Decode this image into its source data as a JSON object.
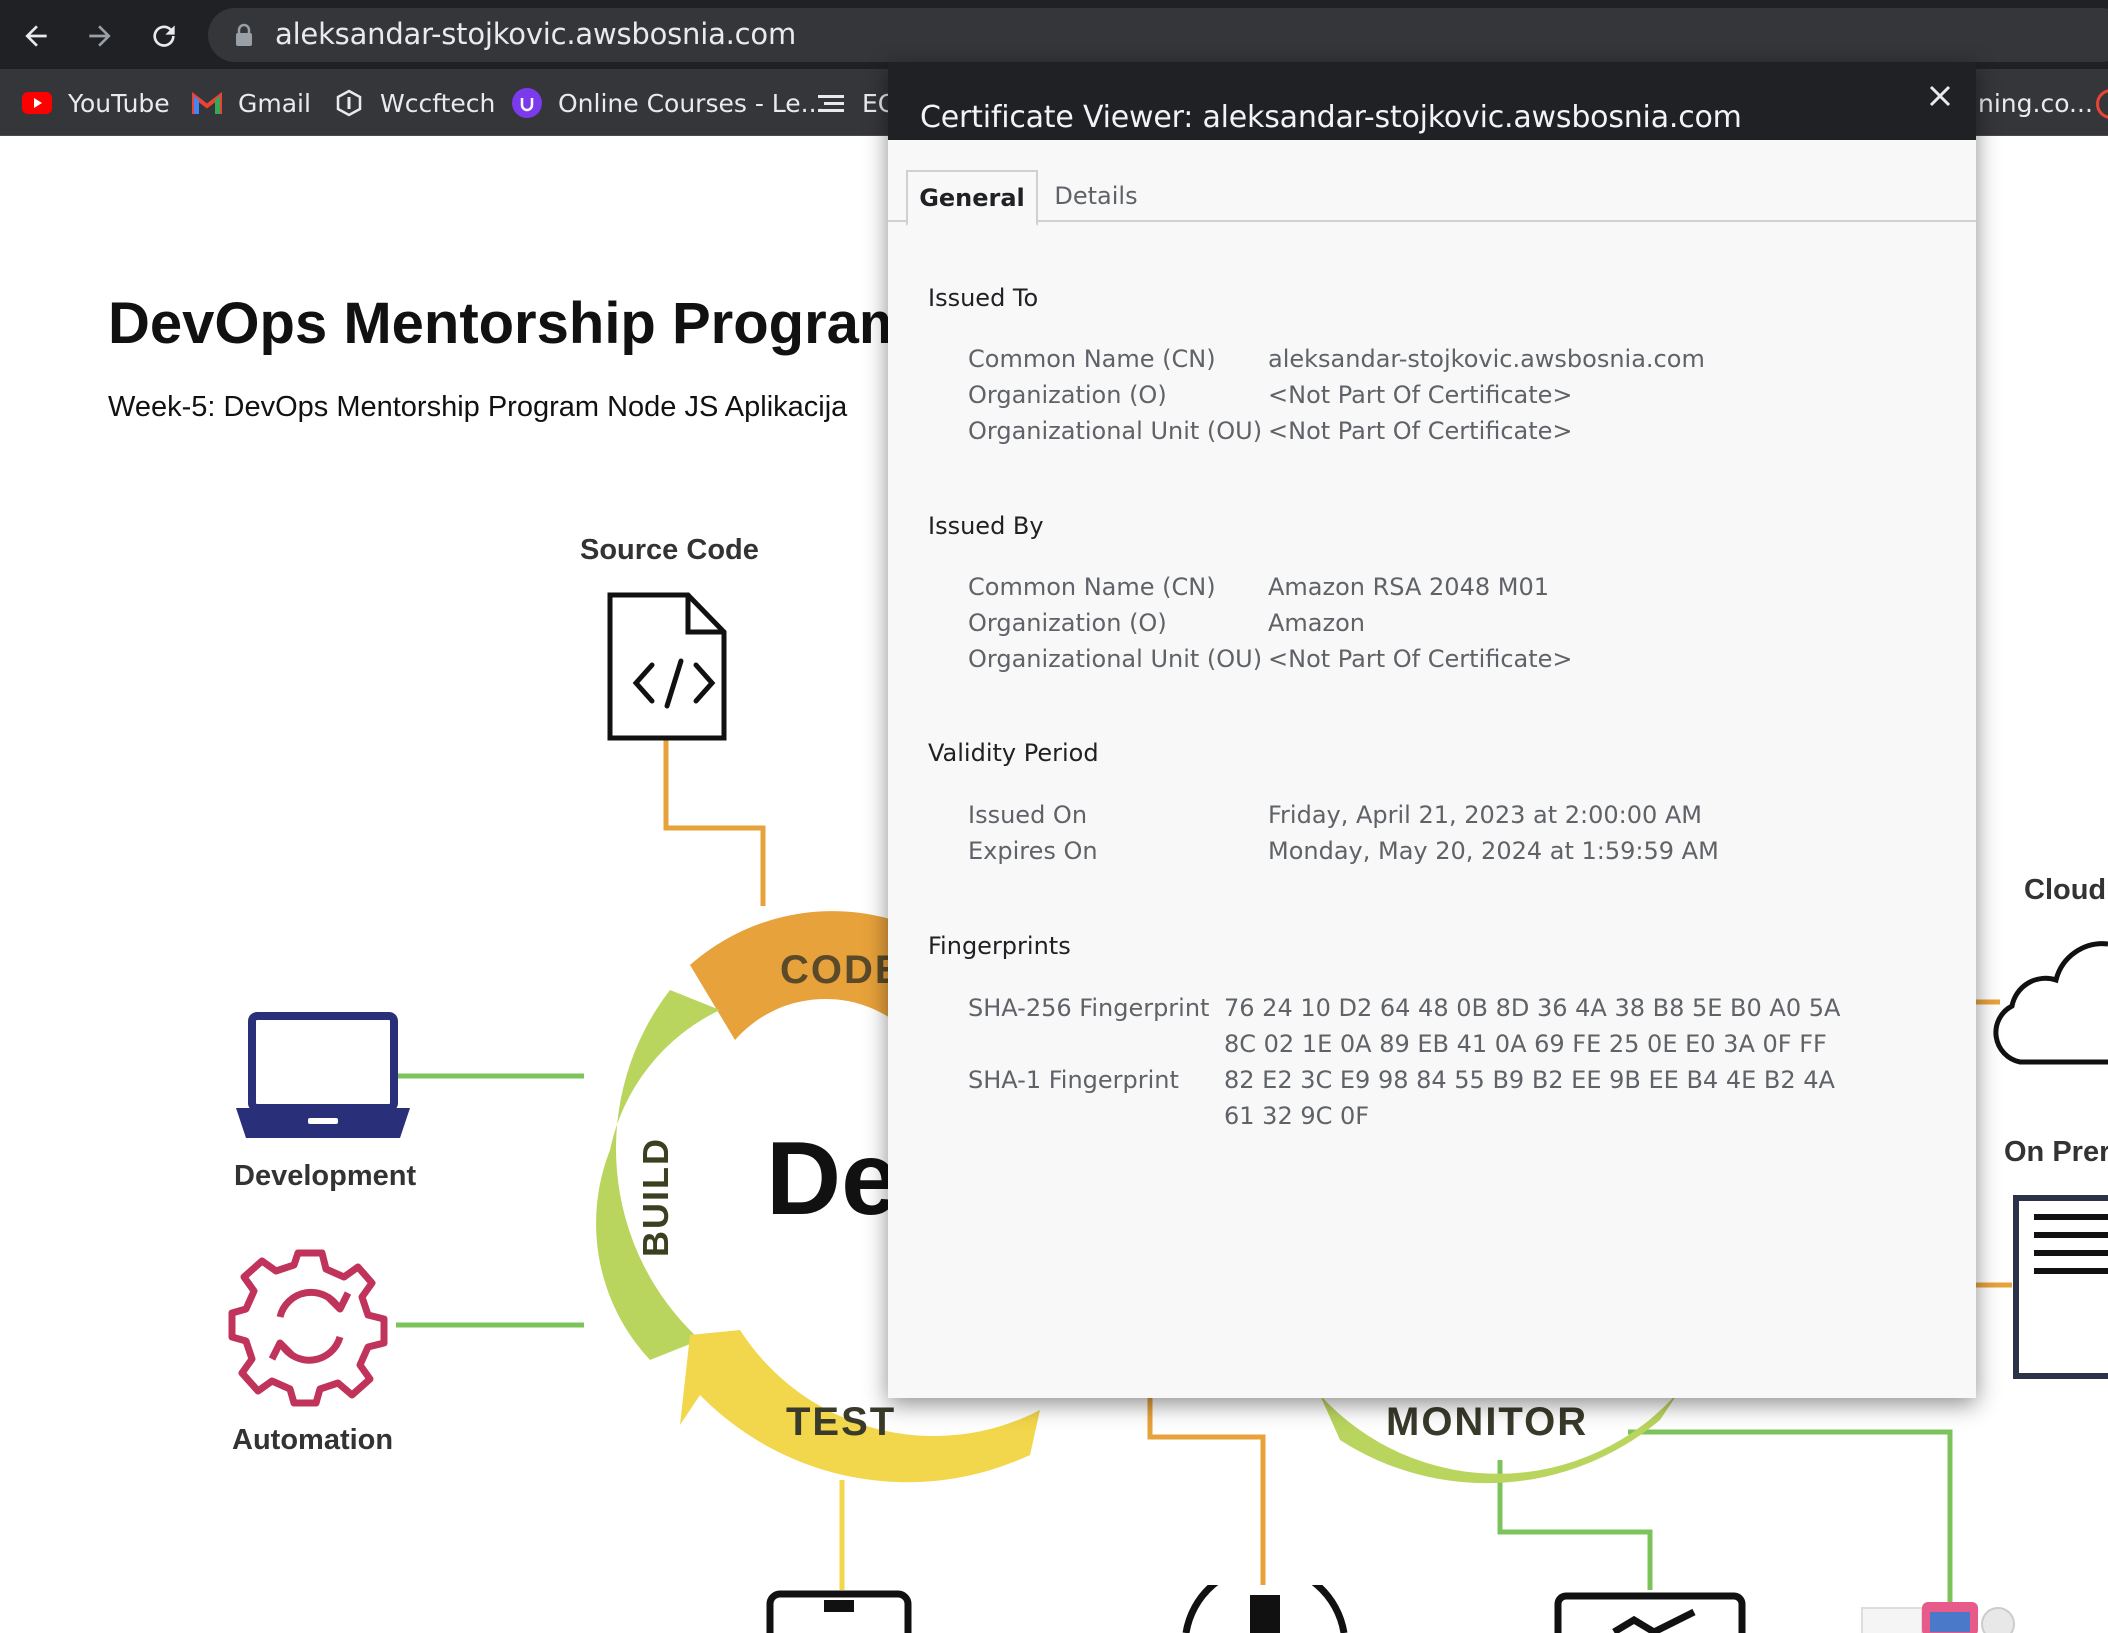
{
  "browser": {
    "url": "aleksandar-stojkovic.awsbosnia.com",
    "bookmarks": [
      {
        "label": "YouTube",
        "icon": "youtube-icon"
      },
      {
        "label": "Gmail",
        "icon": "gmail-icon"
      },
      {
        "label": "Wccftech",
        "icon": "wccftech-icon"
      },
      {
        "label": "Online Courses - Le...",
        "icon": "udemy-icon"
      },
      {
        "label": "EC",
        "icon": "bookmark-icon"
      },
      {
        "label": "ning.co...",
        "icon": "bookmark-icon"
      }
    ]
  },
  "page": {
    "title": "DevOps Mentorship Program",
    "subtitle": "Week-5: DevOps Mentorship Program Node JS Aplikacija",
    "diagram": {
      "source_code": "Source Code",
      "development": "Development",
      "automation": "Automation",
      "cloud": "Cloud",
      "on_prem": "On Prer",
      "cycle_code": "CODE",
      "cycle_build": "BUILD",
      "cycle_test": "TEST",
      "cycle_monitor": "MONITOR",
      "center_text": "De"
    }
  },
  "certificate_viewer": {
    "title": "Certificate Viewer: aleksandar-stojkovic.awsbosnia.com",
    "tabs": [
      "General",
      "Details"
    ],
    "active_tab": "General",
    "issued_to": {
      "heading": "Issued To",
      "rows": [
        {
          "label": "Common Name (CN)",
          "value": "aleksandar-stojkovic.awsbosnia.com"
        },
        {
          "label": "Organization (O)",
          "value": "<Not Part Of Certificate>"
        },
        {
          "label": "Organizational Unit (OU)",
          "value": "<Not Part Of Certificate>"
        }
      ]
    },
    "issued_by": {
      "heading": "Issued By",
      "rows": [
        {
          "label": "Common Name (CN)",
          "value": "Amazon RSA 2048 M01"
        },
        {
          "label": "Organization (O)",
          "value": "Amazon"
        },
        {
          "label": "Organizational Unit (OU)",
          "value": "<Not Part Of Certificate>"
        }
      ]
    },
    "validity": {
      "heading": "Validity Period",
      "rows": [
        {
          "label": "Issued On",
          "value": "Friday, April 21, 2023 at 2:00:00 AM"
        },
        {
          "label": "Expires On",
          "value": "Monday, May 20, 2024 at 1:59:59 AM"
        }
      ]
    },
    "fingerprints": {
      "heading": "Fingerprints",
      "sha256_label": "SHA-256 Fingerprint",
      "sha256_line1": "76 24 10 D2 64 48 0B 8D 36 4A 38 B8 5E B0 A0 5A",
      "sha256_line2": "8C 02 1E 0A 89 EB 41 0A 69 FE 25 0E E0 3A 0F FF",
      "sha1_label": "SHA-1 Fingerprint",
      "sha1_line1": "82 E2 3C E9 98 84 55 B9 B2 EE 9B EE B4 4E B2 4A",
      "sha1_line2": "61 32 9C 0F"
    }
  },
  "colors": {
    "chrome_dark": "#202124",
    "bookmark_bar": "#35363a",
    "dialog_bg": "#f8f8f8",
    "orange": "#e8a23b",
    "green": "#7dc35b",
    "yellow": "#f2d64b",
    "navy": "#2a2f7a",
    "magenta": "#c0335b"
  }
}
